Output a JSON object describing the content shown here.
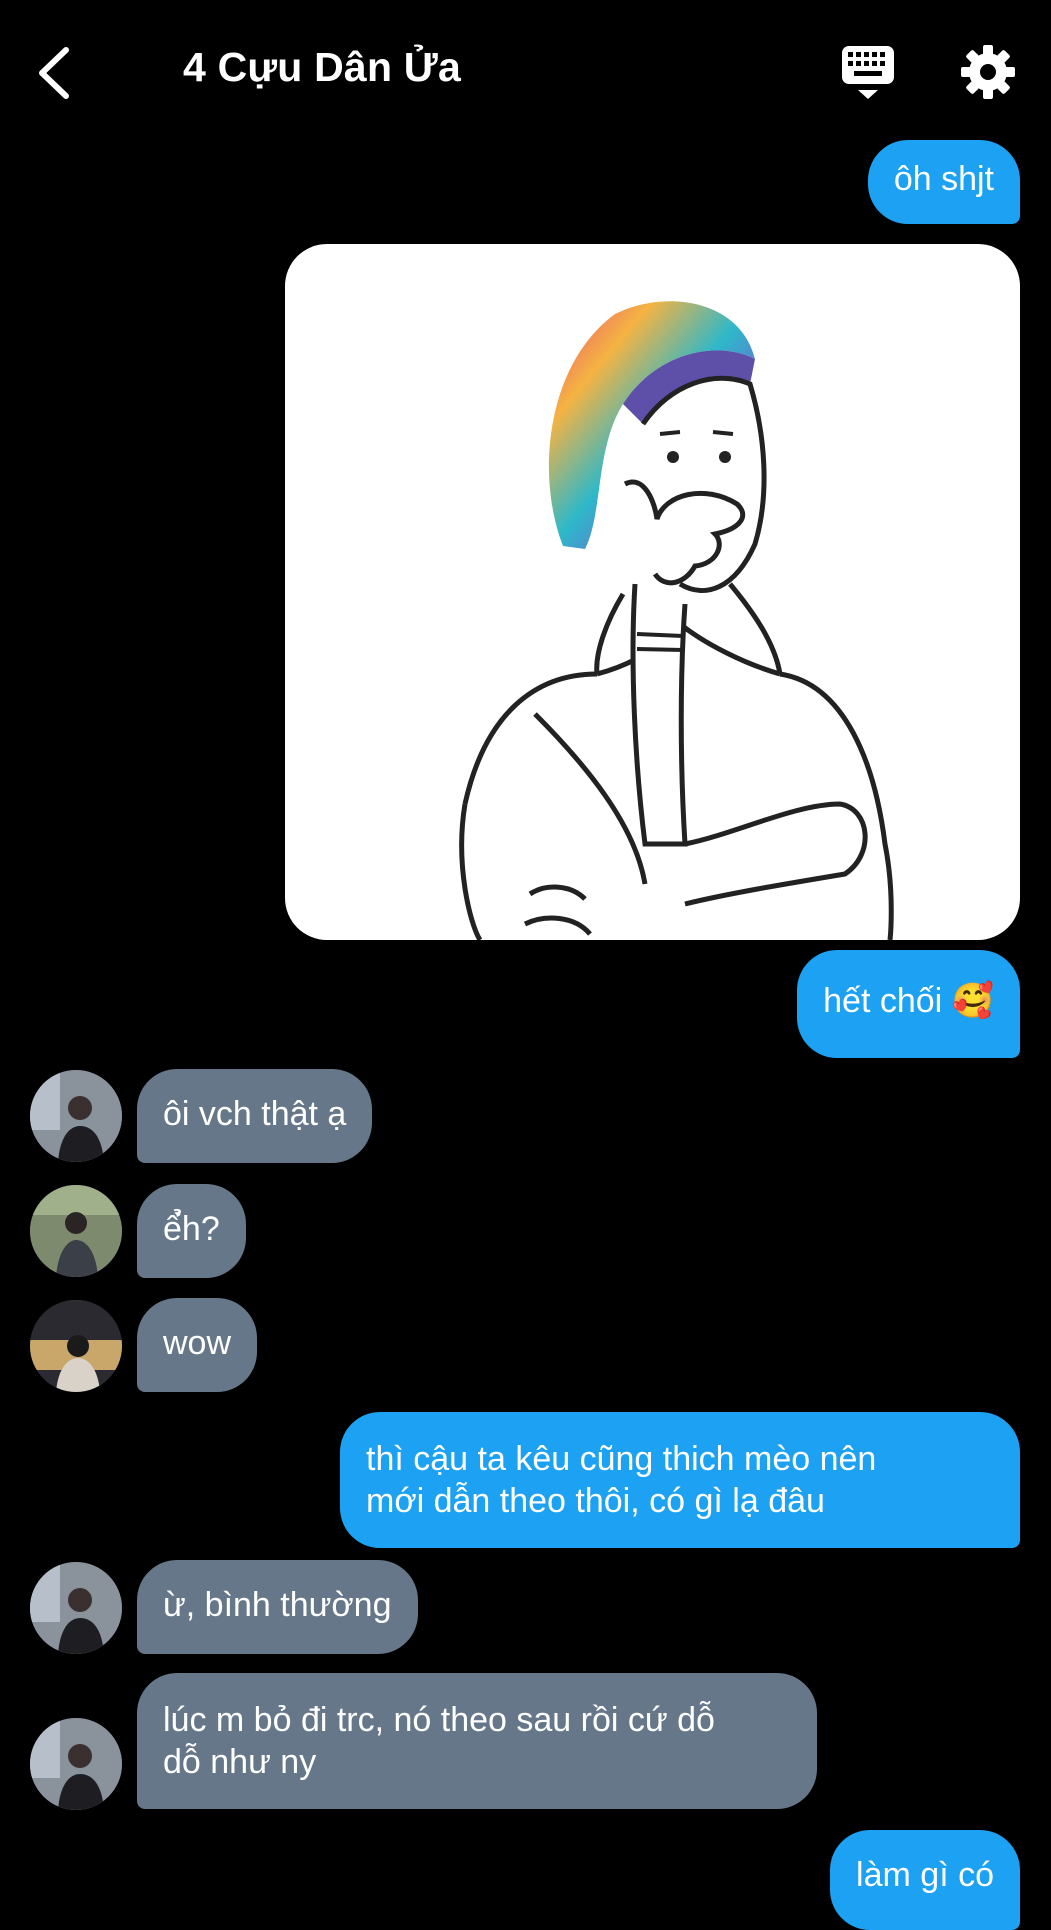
{
  "header": {
    "title": "4 Cựu Dân Ửa",
    "back_icon": "chevron-left-icon",
    "keyboard_icon": "keyboard-icon",
    "settings_icon": "gear-icon"
  },
  "colors": {
    "outgoing_bubble": "#1da1f2",
    "incoming_bubble": "#66778a",
    "background": "#000000"
  },
  "messages": [
    {
      "id": "m1",
      "direction": "outgoing",
      "text": "ôh shjt"
    },
    {
      "id": "m2",
      "direction": "outgoing",
      "type": "image",
      "image": "cartoon-person-covering-mouth-with-colorful-bonnet"
    },
    {
      "id": "m3",
      "direction": "outgoing",
      "text": "hết chối 🥰"
    },
    {
      "id": "m4",
      "direction": "incoming",
      "text": "ôi vch thật ạ"
    },
    {
      "id": "m5",
      "direction": "incoming",
      "text": "ể̉h?"
    },
    {
      "id": "m6",
      "direction": "incoming",
      "text": "wow"
    },
    {
      "id": "m7",
      "direction": "outgoing",
      "text": "thì cậu ta kêu cũng thich mèo nên\nmới dẫn theo thôi, có gì lạ đâu"
    },
    {
      "id": "m8",
      "direction": "incoming",
      "text": "ừ, bình thường"
    },
    {
      "id": "m9",
      "direction": "incoming",
      "text": "lúc m bỏ đi trc, nó theo sau rồi cứ dỗ\ndỗ như ny"
    },
    {
      "id": "m10",
      "direction": "outgoing",
      "text": "làm gì có"
    }
  ]
}
